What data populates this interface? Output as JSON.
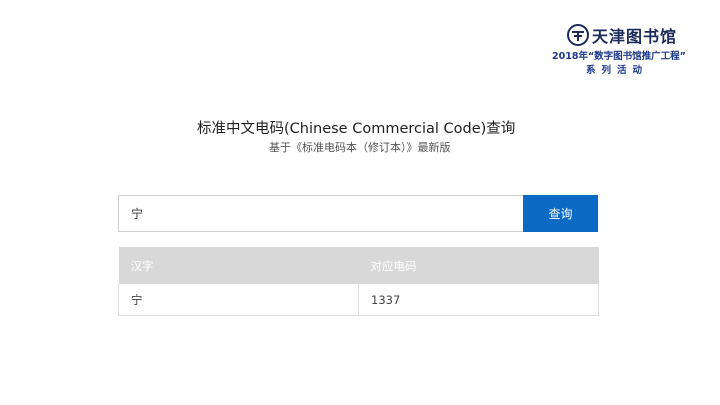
{
  "logo": {
    "icon": "library-emblem-icon",
    "title": "天津图书馆",
    "line1": "2018年“数字图书馆推广工程”",
    "line2": "系列活动"
  },
  "header": {
    "title": "标准中文电码(Chinese Commercial Code)查询",
    "subtitle": "基于《标准电码本（修订本）》最新版"
  },
  "search": {
    "value": "宁",
    "placeholder": "",
    "button_label": "查询"
  },
  "table": {
    "columns": [
      "汉字",
      "对应电码"
    ],
    "rows": [
      [
        "宁",
        "1337"
      ]
    ]
  },
  "colors": {
    "accent": "#0b6ac3",
    "header_bg": "#d8d8d8",
    "logo_blue": "#1f3a8c"
  }
}
